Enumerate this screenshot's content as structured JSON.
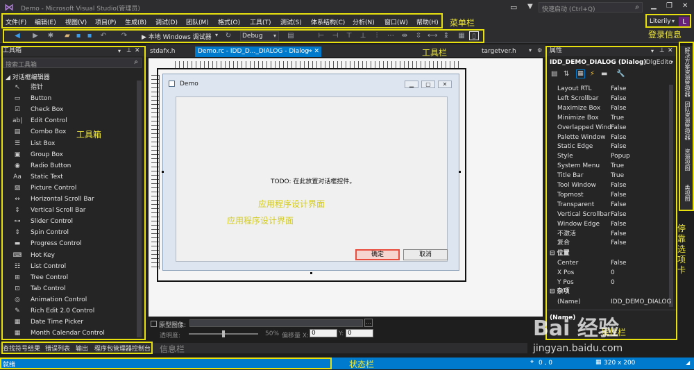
{
  "window": {
    "title": "Demo - Microsoft Visual Studio(管理员)",
    "quick_launch_placeholder": "快速启动 (Ctrl+Q)",
    "user_name": "Literily",
    "user_initial": "L"
  },
  "menu": [
    "文件(F)",
    "编辑(E)",
    "视图(V)",
    "项目(P)",
    "生成(B)",
    "调试(D)",
    "团队(M)",
    "格式(O)",
    "工具(T)",
    "测试(S)",
    "体系结构(C)",
    "分析(N)",
    "窗口(W)",
    "帮助(H)"
  ],
  "toolbar": {
    "run_label": "▶ 本地 Windows 调试器",
    "config": "Debug"
  },
  "toolbox": {
    "title": "工具箱",
    "search_placeholder": "搜索工具箱",
    "group": "◢ 对话框编辑器",
    "items": [
      {
        "icon": "↖",
        "label": "指针"
      },
      {
        "icon": "▭",
        "label": "Button"
      },
      {
        "icon": "☑",
        "label": "Check Box"
      },
      {
        "icon": "ab|",
        "label": "Edit Control"
      },
      {
        "icon": "▤",
        "label": "Combo Box"
      },
      {
        "icon": "☰",
        "label": "List Box"
      },
      {
        "icon": "▣",
        "label": "Group Box"
      },
      {
        "icon": "◉",
        "label": "Radio Button"
      },
      {
        "icon": "Aa",
        "label": "Static Text"
      },
      {
        "icon": "▨",
        "label": "Picture Control"
      },
      {
        "icon": "↔",
        "label": "Horizontal Scroll Bar"
      },
      {
        "icon": "↕",
        "label": "Vertical Scroll Bar"
      },
      {
        "icon": "⊶",
        "label": "Slider Control"
      },
      {
        "icon": "⇕",
        "label": "Spin Control"
      },
      {
        "icon": "▬",
        "label": "Progress Control"
      },
      {
        "icon": "⌨",
        "label": "Hot Key"
      },
      {
        "icon": "☷",
        "label": "List Control"
      },
      {
        "icon": "⊞",
        "label": "Tree Control"
      },
      {
        "icon": "⊡",
        "label": "Tab Control"
      },
      {
        "icon": "◎",
        "label": "Animation Control"
      },
      {
        "icon": "✎",
        "label": "Rich Edit 2.0 Control"
      },
      {
        "icon": "▦",
        "label": "Date Time Picker"
      },
      {
        "icon": "▦",
        "label": "Month Calendar Control"
      }
    ]
  },
  "tabs": {
    "file1": "stdafx.h",
    "active": "Demo.rc - IDD_D..._DIALOG - Dialog",
    "active_pin": "⇔ ✕",
    "file3": "targetver.h"
  },
  "dialog": {
    "title": "Demo",
    "todo": "TODO:  在此放置对话框控件。",
    "ok": "确定",
    "cancel": "取消",
    "minimize": "▁",
    "maximize": "▢",
    "close": "✕"
  },
  "editor_bottom": {
    "overlay_label": "原型图像:",
    "transparency_label": "透明度:",
    "transparency_value": "50%",
    "offset_x_label": "偏移量 X:",
    "offset_x": "0",
    "offset_y_label": "Y:",
    "offset_y": "0",
    "ellipsis": "..."
  },
  "properties": {
    "title": "属性",
    "object": "IDD_DEMO_DIALOG (Dialog)",
    "object_type": "IDlgEditc",
    "rows": [
      {
        "k": "Layout RTL",
        "v": "False"
      },
      {
        "k": "Left Scrollbar",
        "v": "False"
      },
      {
        "k": "Maximize Box",
        "v": "False"
      },
      {
        "k": "Minimize Box",
        "v": "True"
      },
      {
        "k": "Overlapped Wind",
        "v": "False"
      },
      {
        "k": "Palette Window",
        "v": "False"
      },
      {
        "k": "Static Edge",
        "v": "False"
      },
      {
        "k": "Style",
        "v": "Popup"
      },
      {
        "k": "System Menu",
        "v": "True"
      },
      {
        "k": "Title Bar",
        "v": "True"
      },
      {
        "k": "Tool Window",
        "v": "False"
      },
      {
        "k": "Topmost",
        "v": "False"
      },
      {
        "k": "Transparent",
        "v": "False"
      },
      {
        "k": "Vertical Scrollbar",
        "v": "False"
      },
      {
        "k": "Window Edge",
        "v": "False"
      },
      {
        "k": "不激活",
        "v": "False"
      },
      {
        "k": "复合",
        "v": "False"
      }
    ],
    "section_position": "⊟ 位置",
    "pos_rows": [
      {
        "k": "Center",
        "v": "False"
      },
      {
        "k": "X Pos",
        "v": "0"
      },
      {
        "k": "Y Pos",
        "v": "0"
      }
    ],
    "section_misc": "⊟ 杂项",
    "misc_rows": [
      {
        "k": "(Name)",
        "v": "IDD_DEMO_DIALOG"
      }
    ],
    "footer_name": "(Name)"
  },
  "side_tabs": [
    "解决方案资源管理器",
    "团队资源管理器",
    "资源视图",
    "类视图"
  ],
  "bottom_tabs": [
    "查找符号结果",
    "错误列表",
    "输出",
    "程序包管理器控制台"
  ],
  "status": {
    "ready": "就绪",
    "position": "0 , 0",
    "size": "320 x 200"
  },
  "annotations": {
    "menubar": "菜单栏",
    "login": "登录信息",
    "toolbar": "工具栏",
    "toolbox": "工具箱",
    "design1": "应用程序设计界面",
    "design2": "应用程序设计界面",
    "dock_tabs": "停靠选项卡",
    "properties": "属性栏",
    "info": "信息栏",
    "status": "状态栏"
  },
  "watermark": {
    "brand": "Bai 经验",
    "url": "jingyan.baidu.com"
  },
  "colors": {
    "accent": "#007acc",
    "annotation": "#e8e00f",
    "user_badge": "#68217a",
    "ok_button": "#e74c3c"
  }
}
